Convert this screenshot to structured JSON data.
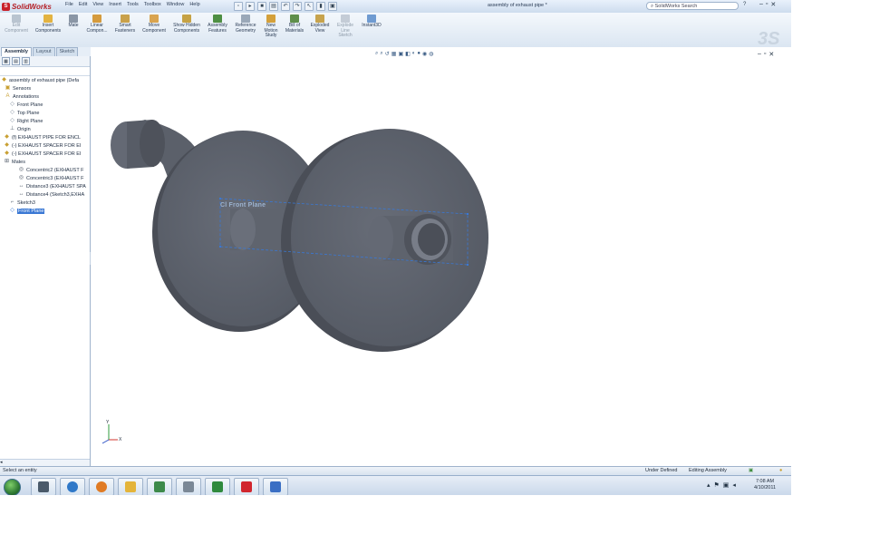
{
  "app": {
    "name": "SolidWorks",
    "menu": [
      "File",
      "Edit",
      "View",
      "Insert",
      "Tools",
      "Toolbox",
      "Window",
      "Help"
    ],
    "document_title": "assembly of exhaust pipe *",
    "search_placeholder": "SolidWorks Search",
    "help_label": "?"
  },
  "toolbar": {
    "edit_component": "Edit Component",
    "insert_components": "Insert Components",
    "mate": "Mate",
    "linear_component": "Linear Compon...",
    "smart_fasteners": "Smart Fasteners",
    "move_component": "Move Component",
    "show_hidden_components": "Show Hidden Components",
    "assembly_features": "Assembly Features",
    "reference_geometry": "Reference Geometry",
    "new_motion_study": "New Motion Study",
    "bill_of_materials": "Bill of Materials",
    "exploded_view": "Exploded View",
    "explode_line_sketch": "Explode Line Sketch",
    "instant3d": "Instant3D"
  },
  "tabs": [
    "Assembly",
    "Layout",
    "Sketch"
  ],
  "tree": {
    "root": "assembly of exhaust pipe  (Defa",
    "items": [
      "Sensors",
      "Annotations",
      "Front Plane",
      "Top Plane",
      "Right Plane",
      "Origin",
      "(f) EXHAUST PIPE FOR ENCL",
      "(-) EXHAUST SPACER FOR EI",
      "(-) EXHAUST SPACER FOR EI",
      "Mates",
      "Concentric2 (EXHAUST F",
      "Concentric3 (EXHAUST F",
      "Distance3 (EXHAUST SPA",
      "Distance4 (Sketch3,EXHA",
      "Sketch3",
      "Front Plane"
    ]
  },
  "viewport": {
    "plane_label": "Front Plane",
    "triad_y": "Y",
    "triad_x": "X"
  },
  "status": {
    "left": "Select an entity",
    "under_defined": "Under Defined",
    "editing": "Editing Assembly"
  },
  "clock": {
    "time": "7:08 AM",
    "date": "4/10/2011"
  },
  "colors": {
    "model_fill": "#5d626d",
    "model_dark": "#4a4e57",
    "selection": "#3a78d4",
    "window_frame": "#d8e4f0"
  }
}
